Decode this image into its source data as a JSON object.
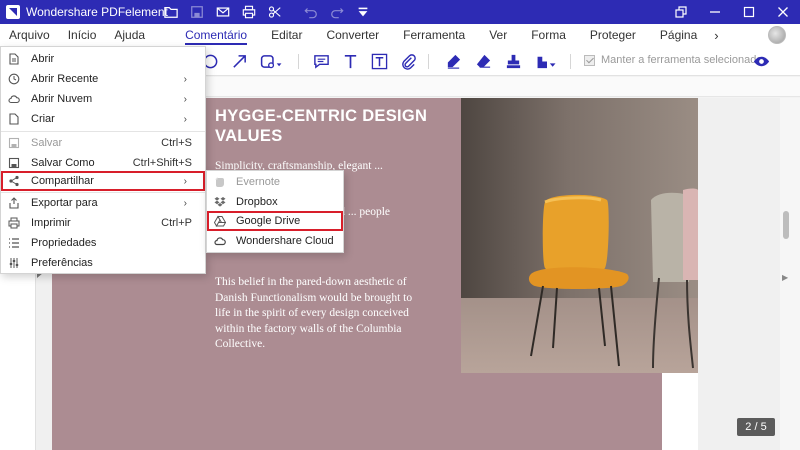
{
  "app": {
    "title": "Wondershare PDFelement"
  },
  "menubar": {
    "items": [
      "Arquivo",
      "Início",
      "Ajuda",
      "Comentário",
      "Editar",
      "Converter",
      "Ferramenta",
      "Ver",
      "Forma",
      "Proteger",
      "Página"
    ],
    "active": "Comentário"
  },
  "toolbar": {
    "keep_tool_label": "Manter a ferramenta selecionada"
  },
  "file_menu": {
    "items": [
      {
        "label": "Abrir",
        "icon": "open-file-icon",
        "shortcut": ""
      },
      {
        "label": "Abrir Recente",
        "icon": "clock-icon",
        "submenu": true
      },
      {
        "label": "Abrir Nuvem",
        "icon": "cloud-icon",
        "submenu": true
      },
      {
        "label": "Criar",
        "icon": "new-file-icon",
        "submenu": true
      },
      {
        "label": "Salvar",
        "icon": "save-icon",
        "shortcut": "Ctrl+S",
        "disabled": true
      },
      {
        "label": "Salvar Como",
        "icon": "save-as-icon",
        "shortcut": "Ctrl+Shift+S"
      },
      {
        "label": "Compartilhar",
        "icon": "share-icon",
        "submenu": true,
        "highlighted": true
      },
      {
        "label": "Exportar para",
        "icon": "export-icon",
        "submenu": true
      },
      {
        "label": "Imprimir",
        "icon": "print-icon",
        "shortcut": "Ctrl+P"
      },
      {
        "label": "Propriedades",
        "icon": "properties-icon"
      },
      {
        "label": "Preferências",
        "icon": "preferences-icon"
      }
    ]
  },
  "share_submenu": {
    "items": [
      {
        "label": "Evernote",
        "icon": "evernote-icon",
        "disabled": true
      },
      {
        "label": "Dropbox",
        "icon": "dropbox-icon"
      },
      {
        "label": "Google Drive",
        "icon": "google-drive-icon",
        "highlighted": true
      },
      {
        "label": "Wondershare Cloud",
        "icon": "wondershare-cloud-icon"
      }
    ]
  },
  "document": {
    "heading": "HYGGE-CENTRIC DESIGN VALUES",
    "paragraph_1": "Simplicity, craftsmanship, elegant ... materials.",
    "paragraph_2": "... there needs ... respect and ... people being built for.",
    "paragraph_3": "This belief in the pared-down aesthetic of Danish Functionalism would be brought to life in the spirit of every design conceived within the factory walls of the Columbia Collective.",
    "page_indicator": "2 / 5"
  },
  "colors": {
    "brand": "#2d2bb4",
    "highlight": "#d81e2a",
    "page_background": "#ac8c92"
  }
}
